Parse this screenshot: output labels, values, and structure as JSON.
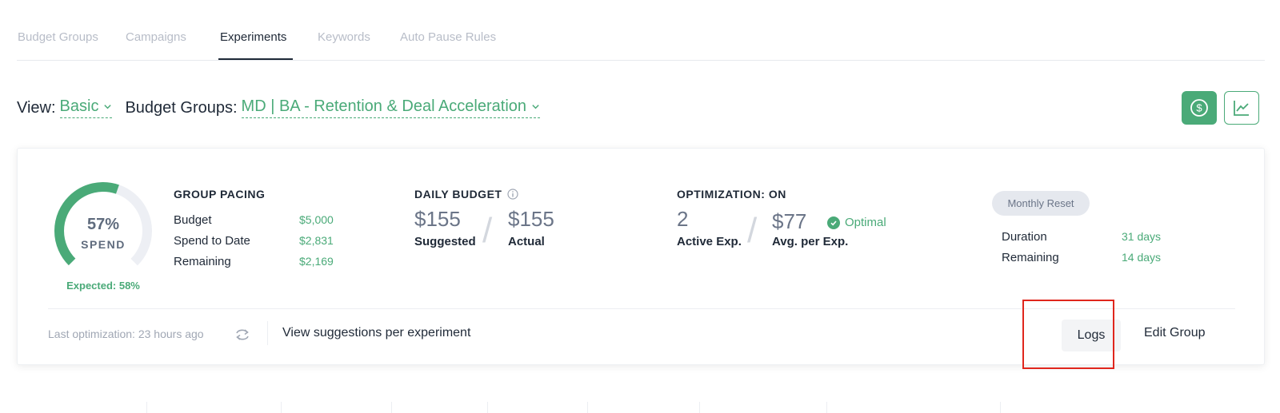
{
  "tabs": [
    {
      "label": "Budget Groups",
      "active": false
    },
    {
      "label": "Campaigns",
      "active": false
    },
    {
      "label": "Experiments",
      "active": true
    },
    {
      "label": "Keywords",
      "active": false
    },
    {
      "label": "Auto Pause Rules",
      "active": false
    }
  ],
  "filters": {
    "view_label": "View:",
    "view_value": "Basic",
    "budget_groups_label": "Budget Groups:",
    "budget_groups_value": "MD | BA - Retention & Deal Acceleration"
  },
  "toolbar": {
    "spend_view_icon": "dollar-circle-icon",
    "chart_view_icon": "line-chart-icon"
  },
  "gauge": {
    "percent_label": "57%",
    "spend_fraction": 0.57,
    "label": "SPEND",
    "expected": "Expected: 58%"
  },
  "group_pacing": {
    "title": "GROUP PACING",
    "rows": [
      {
        "label": "Budget",
        "value": "$5,000"
      },
      {
        "label": "Spend to Date",
        "value": "$2,831"
      },
      {
        "label": "Remaining",
        "value": "$2,169"
      }
    ]
  },
  "daily_budget": {
    "title": "DAILY BUDGET",
    "suggested_value": "$155",
    "suggested_label": "Suggested",
    "actual_value": "$155",
    "actual_label": "Actual"
  },
  "optimization": {
    "title": "OPTIMIZATION: ON",
    "active_value": "2",
    "active_label": "Active Exp.",
    "avg_value": "$77",
    "avg_label": "Avg. per Exp.",
    "status": "Optimal"
  },
  "reset": {
    "badge": "Monthly Reset",
    "rows": [
      {
        "label": "Duration",
        "value": "31 days"
      },
      {
        "label": "Remaining",
        "value": "14 days"
      }
    ]
  },
  "footer": {
    "last_optimization": "Last optimization: 23 hours ago",
    "view_suggestions": "View suggestions per experiment",
    "logs": "Logs",
    "edit_group": "Edit Group"
  },
  "colors": {
    "accent": "#4aaa78",
    "highlight": "#e0261d"
  }
}
